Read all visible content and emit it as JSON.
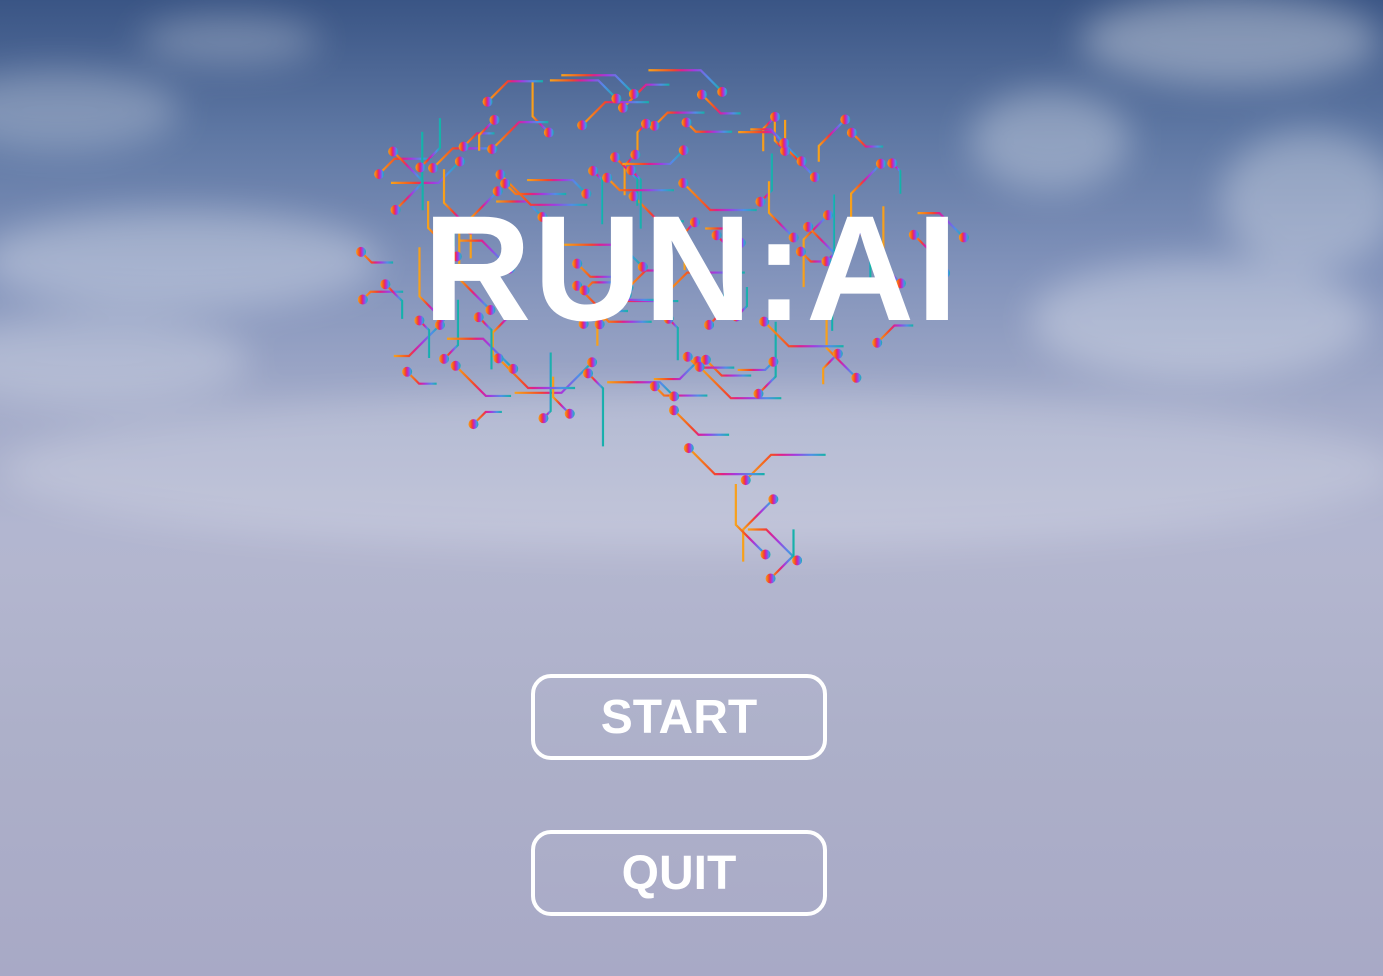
{
  "title": "RUN:AI",
  "menu": {
    "start_label": "START",
    "quit_label": "QUIT"
  },
  "colors": {
    "left": "#f7a21b",
    "mid_left": "#f2442e",
    "center": "#e0208a",
    "mid_right": "#a23be0",
    "right_blue": "#4f8ee8",
    "right": "#14b3a7"
  },
  "icons": {
    "logo": "circuit-brain-icon"
  }
}
